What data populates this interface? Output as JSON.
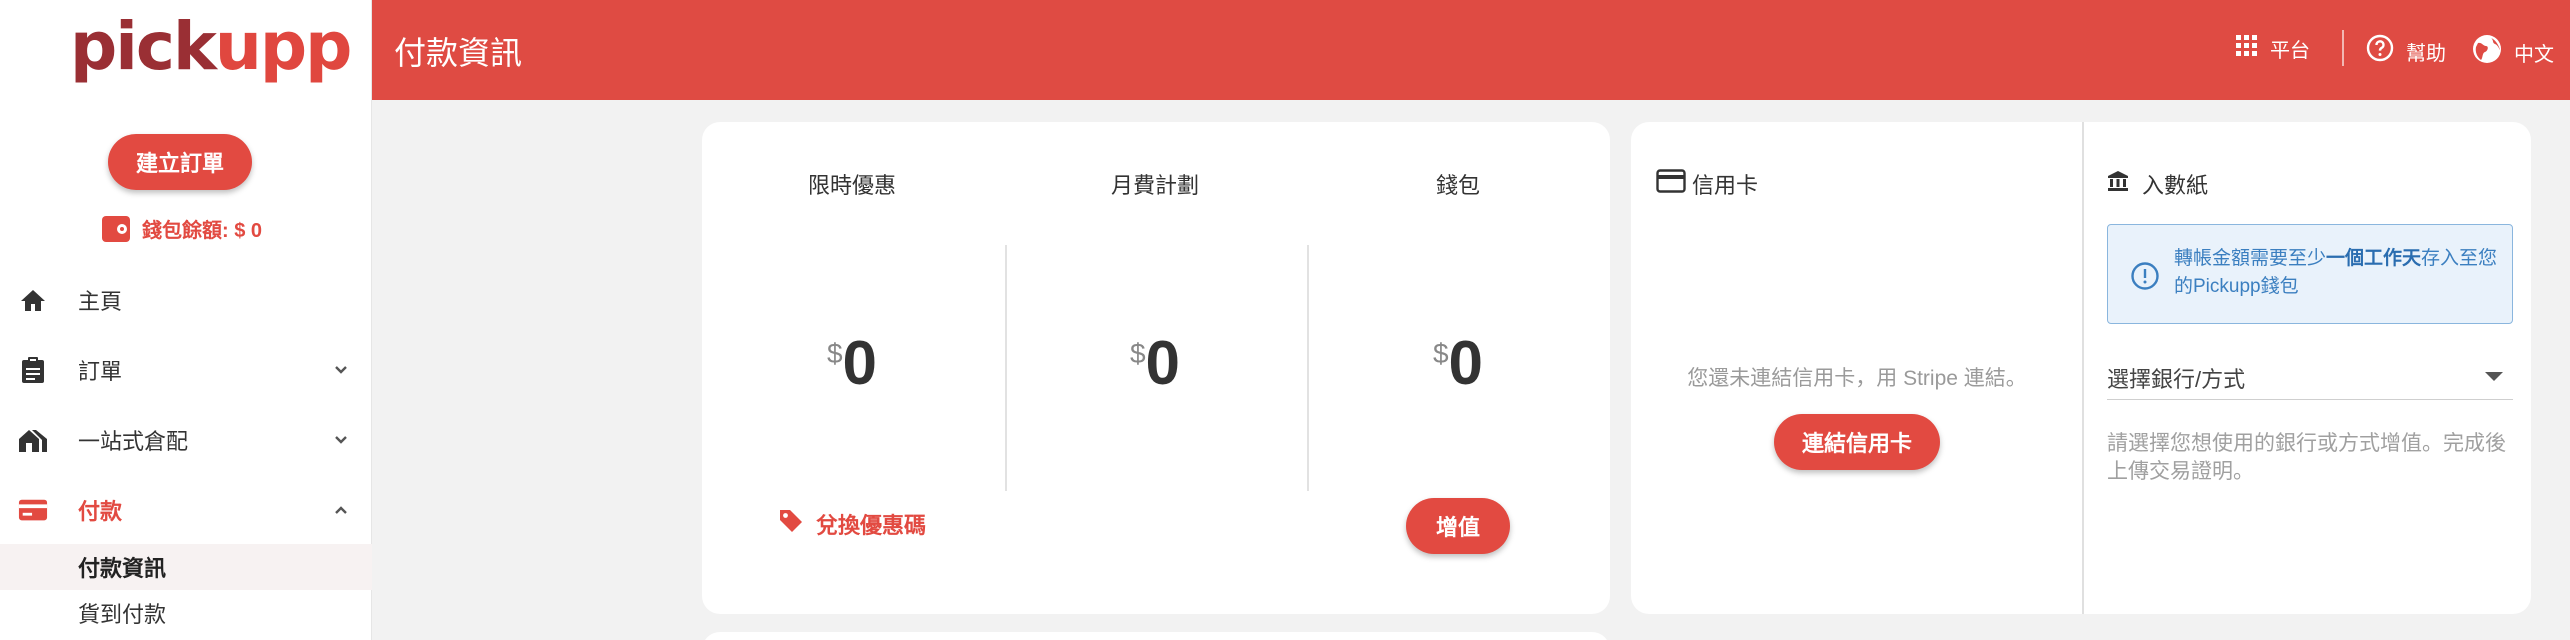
{
  "brand": {
    "logo_part1": "pick",
    "logo_part2": "upp"
  },
  "sidebar": {
    "create_order_label": "建立訂單",
    "wallet_balance": "錢包餘額: $ 0",
    "items": [
      {
        "label": "主頁"
      },
      {
        "label": "訂單"
      },
      {
        "label": "一站式倉配"
      },
      {
        "label": "付款"
      }
    ],
    "payment_subitems": [
      {
        "label": "付款資訊"
      },
      {
        "label": "貨到付款"
      }
    ]
  },
  "header": {
    "title": "付款資訊",
    "platform_label": "平台",
    "help_label": "幫助",
    "language_label": "中文"
  },
  "summary": {
    "limited_offer_title": "限時優惠",
    "monthly_plan_title": "月費計劃",
    "wallet_title": "錢包",
    "currency_symbol": "$",
    "limited_offer_amount": "0",
    "monthly_plan_amount": "0",
    "wallet_amount": "0",
    "redeem_label": "兌換優惠碼",
    "topup_label": "增值"
  },
  "credit_card": {
    "title": "信用卡",
    "message": "您還未連結信用卡，用 Stripe 連結。",
    "connect_label": "連結信用卡"
  },
  "bank_slip": {
    "title": "入數紙",
    "notice_pre": "轉帳金額需要至少",
    "notice_bold": "一個工作天",
    "notice_post": "存入至您的Pickupp錢包",
    "select_value": "選擇銀行/方式",
    "help_text": "請選擇您想使用的銀行或方式增值。完成後上傳交易證明。"
  },
  "colors": {
    "brand_red": "#e24a41",
    "header_red": "#df4b43",
    "logo_dark": "#9a2f34"
  }
}
